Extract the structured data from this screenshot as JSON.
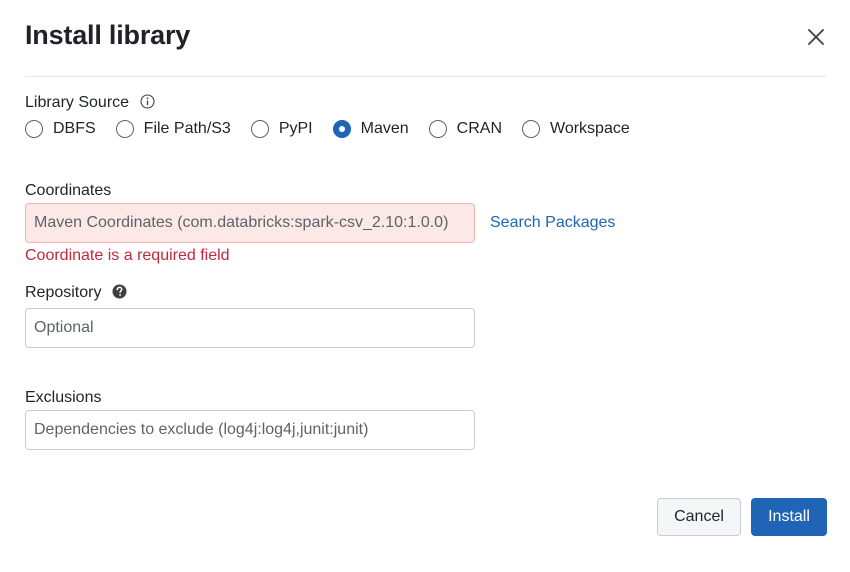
{
  "dialog": {
    "title": "Install library",
    "close_icon": "close-icon"
  },
  "library_source": {
    "label": "Library Source",
    "info_icon": "info-icon",
    "options": [
      {
        "label": "DBFS",
        "checked": false
      },
      {
        "label": "File Path/S3",
        "checked": false
      },
      {
        "label": "PyPI",
        "checked": false
      },
      {
        "label": "Maven",
        "checked": true
      },
      {
        "label": "CRAN",
        "checked": false
      },
      {
        "label": "Workspace",
        "checked": false
      }
    ]
  },
  "coordinates": {
    "label": "Coordinates",
    "placeholder": "Maven Coordinates (com.databricks:spark-csv_2.10:1.0.0)",
    "value": "",
    "search_link": "Search Packages",
    "error": "Coordinate is a required field"
  },
  "repository": {
    "label": "Repository",
    "help_icon": "question-circle-icon",
    "placeholder": "Optional",
    "value": ""
  },
  "exclusions": {
    "label": "Exclusions",
    "placeholder": "Dependencies to exclude (log4j:log4j,junit:junit)",
    "value": ""
  },
  "footer": {
    "cancel_label": "Cancel",
    "install_label": "Install"
  },
  "colors": {
    "primary": "#1f64b5",
    "error_text": "#c6263a",
    "error_background": "#fde8e8"
  }
}
